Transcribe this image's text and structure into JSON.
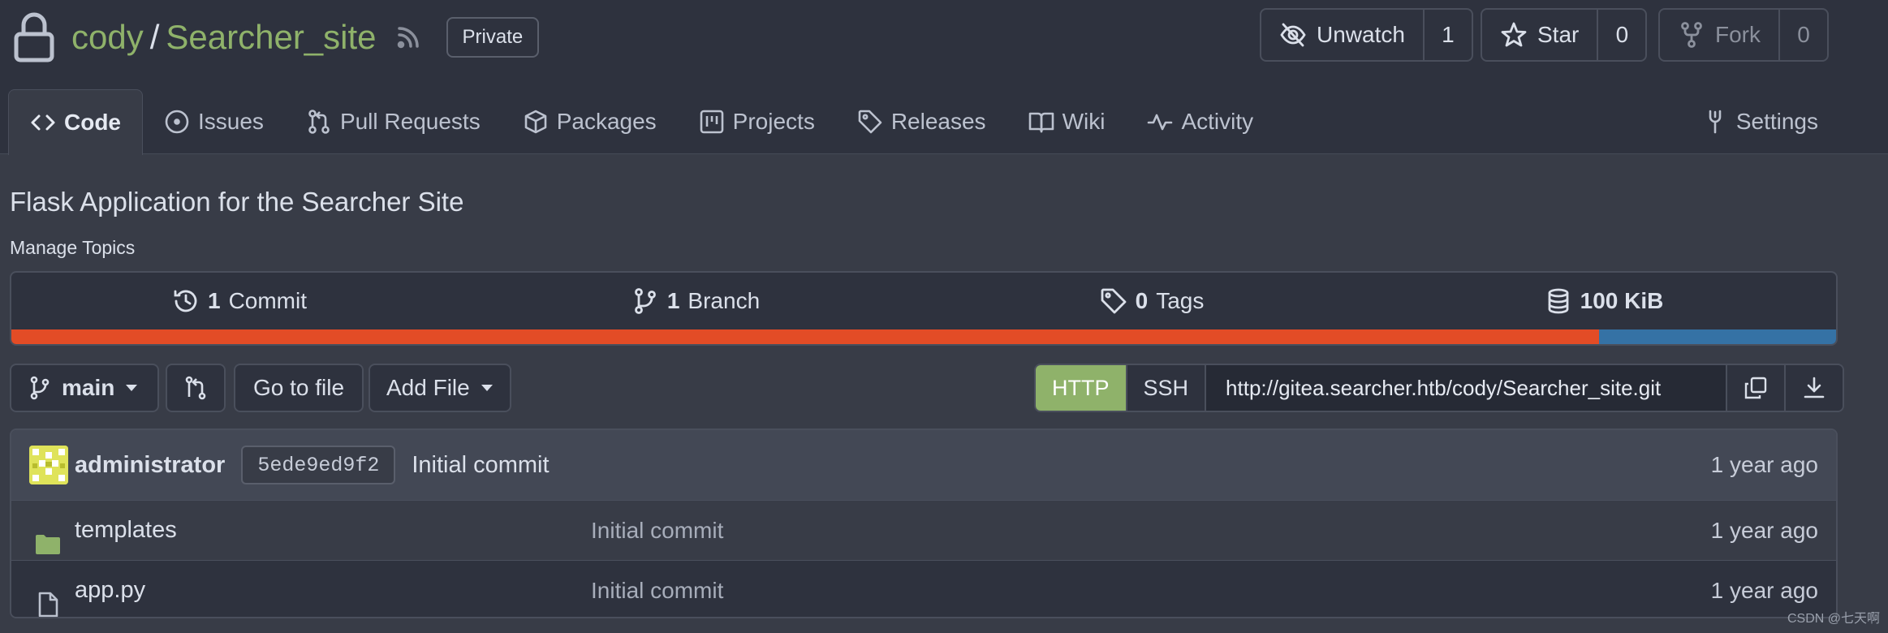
{
  "repo": {
    "owner": "cody",
    "separator": "/",
    "name": "Searcher_site",
    "visibility_badge": "Private",
    "description": "Flask Application for the Searcher Site",
    "manage_topics": "Manage Topics"
  },
  "actions": {
    "watch": {
      "label": "Unwatch",
      "count": "1",
      "icon": "eye-slash-icon"
    },
    "star": {
      "label": "Star",
      "count": "0",
      "icon": "star-icon"
    },
    "fork": {
      "label": "Fork",
      "count": "0",
      "icon": "fork-icon",
      "disabled": true
    }
  },
  "tabs": [
    {
      "label": "Code",
      "icon": "code-icon",
      "active": true
    },
    {
      "label": "Issues",
      "icon": "issue-icon"
    },
    {
      "label": "Pull Requests",
      "icon": "pull-request-icon"
    },
    {
      "label": "Packages",
      "icon": "package-icon"
    },
    {
      "label": "Projects",
      "icon": "project-icon"
    },
    {
      "label": "Releases",
      "icon": "tag-icon"
    },
    {
      "label": "Wiki",
      "icon": "book-icon"
    },
    {
      "label": "Activity",
      "icon": "pulse-icon"
    }
  ],
  "settings_tab": {
    "label": "Settings",
    "icon": "tools-icon"
  },
  "stats": {
    "commits": {
      "count": "1",
      "label": "Commit"
    },
    "branches": {
      "count": "1",
      "label": "Branch"
    },
    "tags": {
      "count": "0",
      "label": "Tags"
    },
    "size": {
      "value": "100 KiB"
    }
  },
  "language_bar": {
    "segments": [
      {
        "color": "#e34c26",
        "fraction": 0.87
      },
      {
        "color": "#3572a5",
        "fraction": 0.13
      }
    ]
  },
  "toolbar": {
    "branch": "main",
    "go_to_file": "Go to file",
    "add_file": "Add File",
    "clone_http": "HTTP",
    "clone_ssh": "SSH",
    "clone_url": "http://gitea.searcher.htb/cody/Searcher_site.git"
  },
  "latest_commit": {
    "author": "administrator",
    "sha": "5ede9ed9f2",
    "message": "Initial commit",
    "age": "1 year ago"
  },
  "files": [
    {
      "name": "templates",
      "type": "folder",
      "commit": "Initial commit",
      "age": "1 year ago"
    },
    {
      "name": "app.py",
      "type": "file",
      "commit": "Initial commit",
      "age": "1 year ago"
    }
  ],
  "watermark": "CSDN @七天啊",
  "colors": {
    "accent_green": "#8fb26a",
    "background": "#383c47",
    "header_bg": "#2e323e"
  }
}
